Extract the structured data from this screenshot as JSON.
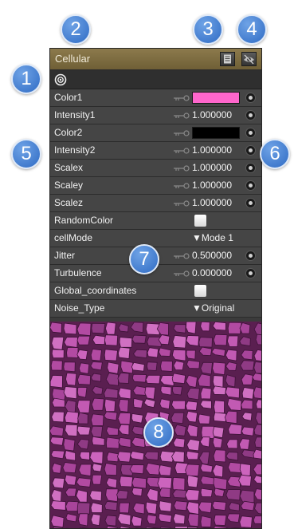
{
  "panel": {
    "title": "Cellular",
    "toolbar_icons": [
      "list-icon",
      "eye-icon"
    ]
  },
  "properties": [
    {
      "label": "Color1",
      "type": "color",
      "color": "#ff66cc"
    },
    {
      "label": "Intensity1",
      "type": "number",
      "value": "1.000000"
    },
    {
      "label": "Color2",
      "type": "color",
      "color": "#000000"
    },
    {
      "label": "Intensity2",
      "type": "number",
      "value": "1.000000"
    },
    {
      "label": "Scalex",
      "type": "number",
      "value": "1.000000"
    },
    {
      "label": "Scaley",
      "type": "number",
      "value": "1.000000"
    },
    {
      "label": "Scalez",
      "type": "number",
      "value": "1.000000"
    },
    {
      "label": "RandomColor",
      "type": "checkbox"
    },
    {
      "label": "cellMode",
      "type": "dropdown",
      "value": "Mode 1"
    },
    {
      "label": "Jitter",
      "type": "number",
      "value": "0.500000"
    },
    {
      "label": "Turbulence",
      "type": "number",
      "value": "0.000000"
    },
    {
      "label": "Global_coordinates",
      "type": "checkbox"
    },
    {
      "label": "Noise_Type",
      "type": "dropdown",
      "value": "Original"
    }
  ],
  "dropdown_arrow": "▼",
  "callouts": [
    "1",
    "2",
    "3",
    "4",
    "5",
    "6",
    "7",
    "8"
  ],
  "colors": {
    "title_bar": "#7d6b40",
    "panel_bg": "#3b3b3b",
    "row_bg": "#454545",
    "callout_blue": "#3d78cf",
    "preview_cell": "#c056b0",
    "preview_edge": "#5a1f50"
  }
}
